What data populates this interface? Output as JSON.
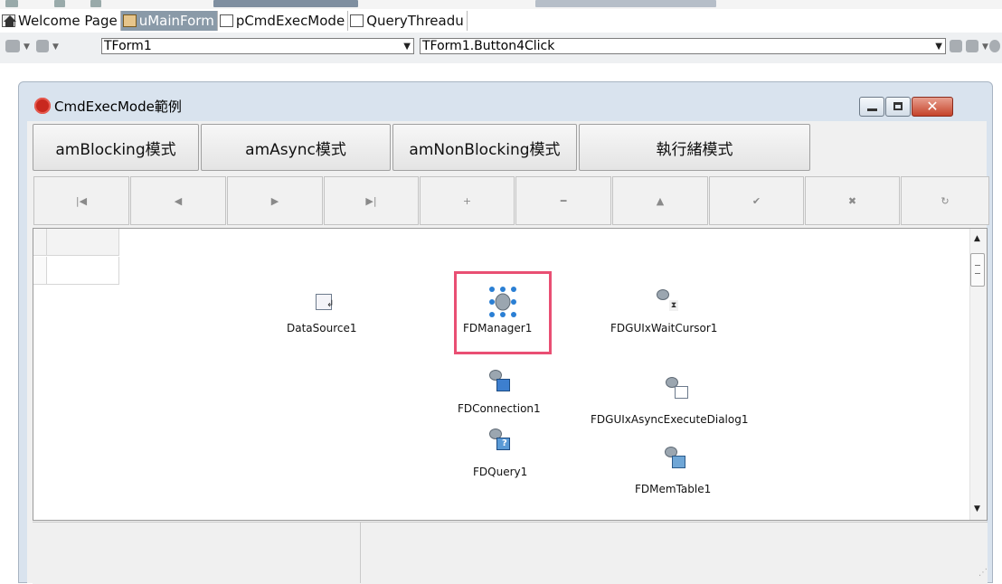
{
  "tabs": [
    {
      "label": "Welcome Page",
      "icon": "home-icon",
      "active": false
    },
    {
      "label": "uMainForm",
      "icon": "form-icon",
      "active": true
    },
    {
      "label": "pCmdExecMode",
      "icon": "unit-icon",
      "active": false
    },
    {
      "label": "QueryThreadu",
      "icon": "document-icon",
      "active": false
    }
  ],
  "toolbar": {
    "class_combo": "TForm1",
    "method_combo": "TForm1.Button4Click"
  },
  "form": {
    "title": "CmdExecMode範例",
    "mode_buttons": [
      "amBlocking模式",
      "amAsync模式",
      "amNonBlocking模式",
      "執行緒模式"
    ]
  },
  "navigator": {
    "buttons": [
      {
        "name": "first-record",
        "glyph": "|◀"
      },
      {
        "name": "prior-record",
        "glyph": "◀"
      },
      {
        "name": "next-record",
        "glyph": "▶"
      },
      {
        "name": "last-record",
        "glyph": "▶|"
      },
      {
        "name": "insert-record",
        "glyph": "+"
      },
      {
        "name": "delete-record",
        "glyph": "━"
      },
      {
        "name": "edit-record",
        "glyph": "▲"
      },
      {
        "name": "post-record",
        "glyph": "✔"
      },
      {
        "name": "cancel-record",
        "glyph": "✖"
      },
      {
        "name": "refresh-record",
        "glyph": "↻"
      }
    ]
  },
  "components": {
    "datasource": "DataSource1",
    "fdmanager": "FDManager1",
    "waitcursor": "FDGUIxWaitCursor1",
    "connection": "FDConnection1",
    "asyncdialog": "FDGUIxAsyncExecuteDialog1",
    "query": "FDQuery1",
    "memtable": "FDMemTable1"
  },
  "colors": {
    "highlight": "#e94f73",
    "active_tab": "#8a9aa8",
    "app_icon": "#c8281e"
  }
}
